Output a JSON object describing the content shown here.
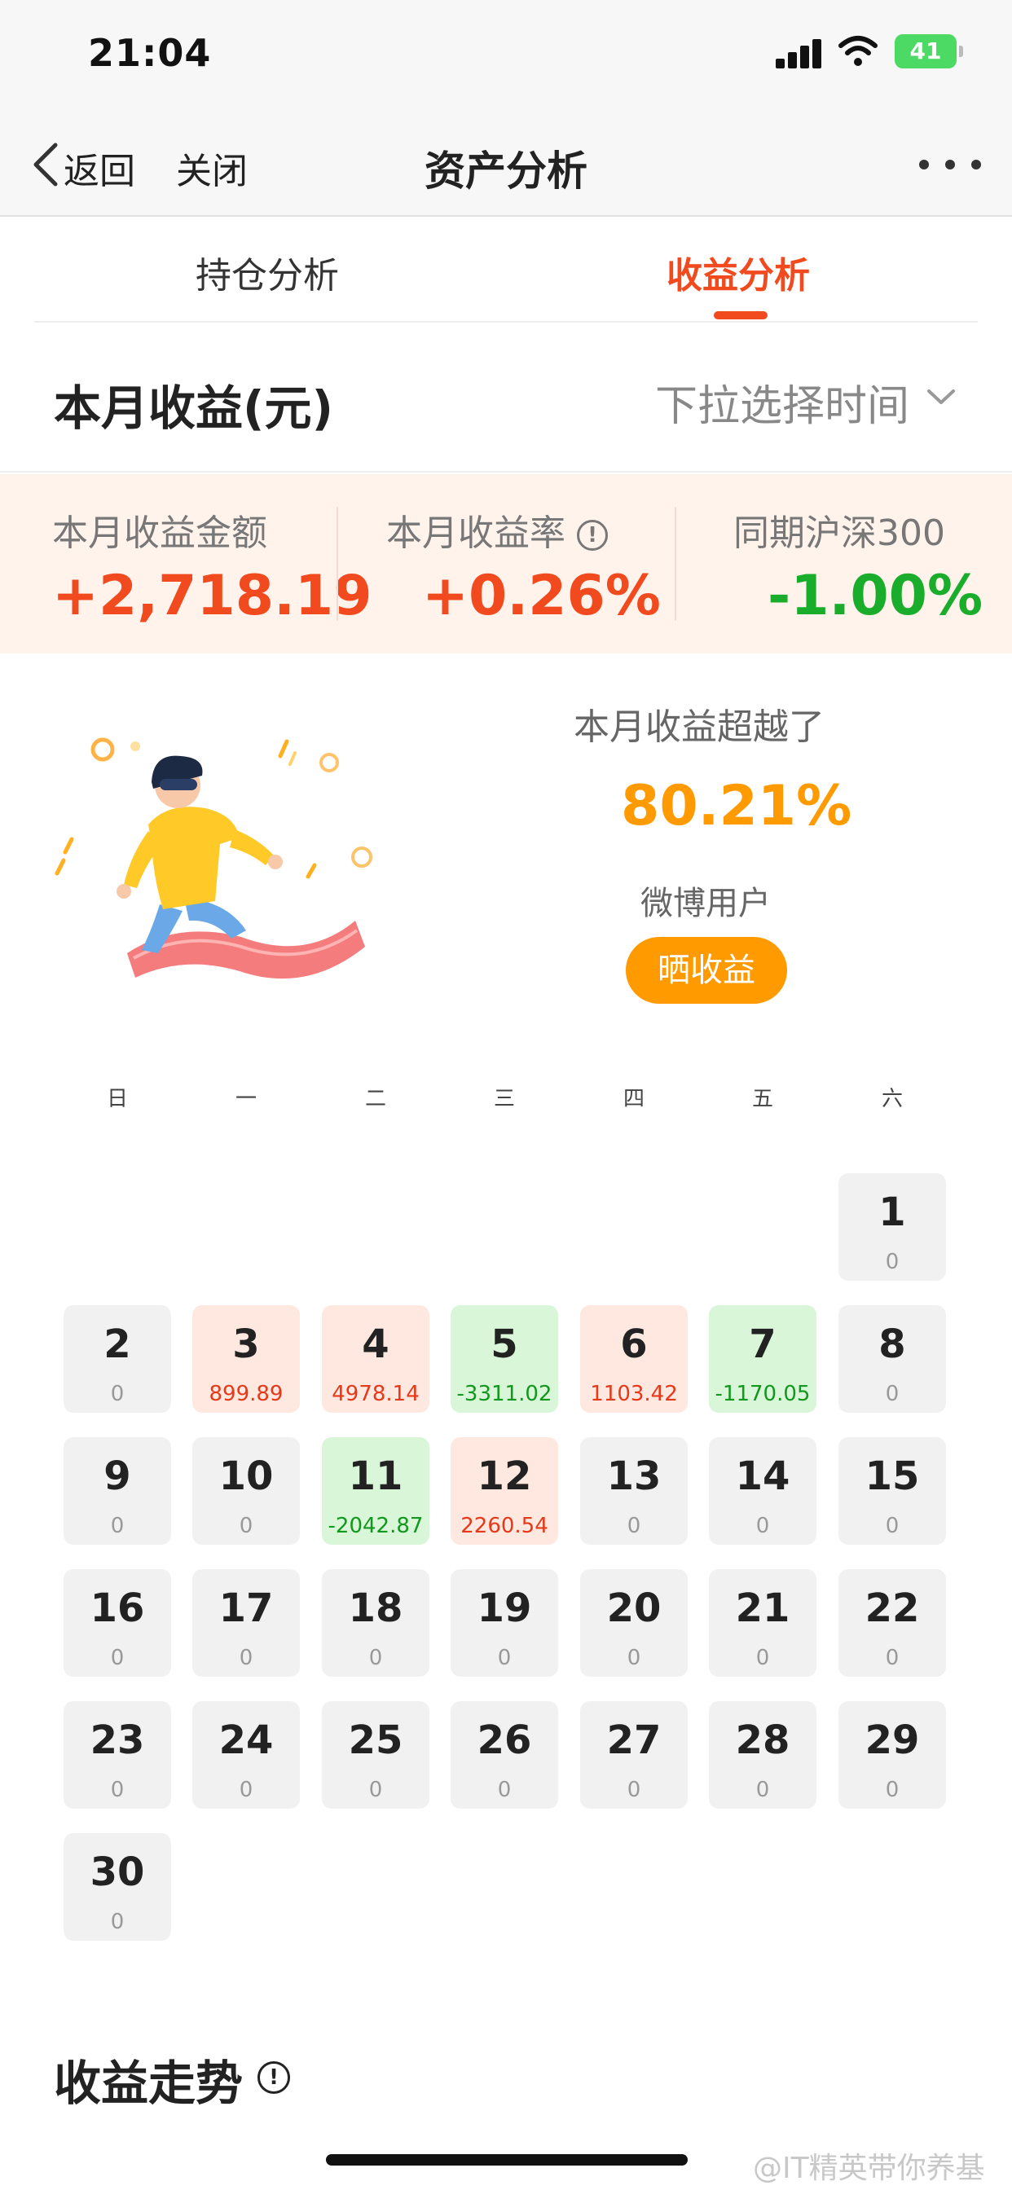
{
  "status_bar": {
    "time": "21:04",
    "battery": "41"
  },
  "nav": {
    "back_label": "返回",
    "close_label": "关闭",
    "title": "资产分析"
  },
  "tabs": [
    {
      "label": "持仓分析",
      "active": false
    },
    {
      "label": "收益分析",
      "active": true
    }
  ],
  "month": {
    "title": "本月收益(元)",
    "time_select": "下拉选择时间"
  },
  "stats": [
    {
      "label": "本月收益金额",
      "value": "+2,718.19"
    },
    {
      "label": "本月收益率",
      "value": "+0.26%"
    },
    {
      "label": "同期沪深300",
      "value": "-1.00%"
    }
  ],
  "beat": {
    "label": "本月收益超越了",
    "value": "80.21%",
    "users": "微博用户",
    "share_label": "晒收益"
  },
  "weekdays": [
    "日",
    "一",
    "二",
    "三",
    "四",
    "五",
    "六"
  ],
  "calendar": {
    "first_weekday": 6,
    "days": [
      {
        "day": "1",
        "amount": "0",
        "status": "zero"
      },
      {
        "day": "2",
        "amount": "0",
        "status": "zero"
      },
      {
        "day": "3",
        "amount": "899.89",
        "status": "pos"
      },
      {
        "day": "4",
        "amount": "4978.14",
        "status": "pos"
      },
      {
        "day": "5",
        "amount": "-3311.02",
        "status": "neg"
      },
      {
        "day": "6",
        "amount": "1103.42",
        "status": "pos"
      },
      {
        "day": "7",
        "amount": "-1170.05",
        "status": "neg"
      },
      {
        "day": "8",
        "amount": "0",
        "status": "zero"
      },
      {
        "day": "9",
        "amount": "0",
        "status": "zero"
      },
      {
        "day": "10",
        "amount": "0",
        "status": "zero"
      },
      {
        "day": "11",
        "amount": "-2042.87",
        "status": "neg"
      },
      {
        "day": "12",
        "amount": "2260.54",
        "status": "pos"
      },
      {
        "day": "13",
        "amount": "0",
        "status": "zero"
      },
      {
        "day": "14",
        "amount": "0",
        "status": "zero"
      },
      {
        "day": "15",
        "amount": "0",
        "status": "zero"
      },
      {
        "day": "16",
        "amount": "0",
        "status": "zero"
      },
      {
        "day": "17",
        "amount": "0",
        "status": "zero"
      },
      {
        "day": "18",
        "amount": "0",
        "status": "zero"
      },
      {
        "day": "19",
        "amount": "0",
        "status": "zero"
      },
      {
        "day": "20",
        "amount": "0",
        "status": "zero"
      },
      {
        "day": "21",
        "amount": "0",
        "status": "zero"
      },
      {
        "day": "22",
        "amount": "0",
        "status": "zero"
      },
      {
        "day": "23",
        "amount": "0",
        "status": "zero"
      },
      {
        "day": "24",
        "amount": "0",
        "status": "zero"
      },
      {
        "day": "25",
        "amount": "0",
        "status": "zero"
      },
      {
        "day": "26",
        "amount": "0",
        "status": "zero"
      },
      {
        "day": "27",
        "amount": "0",
        "status": "zero"
      },
      {
        "day": "28",
        "amount": "0",
        "status": "zero"
      },
      {
        "day": "29",
        "amount": "0",
        "status": "zero"
      },
      {
        "day": "30",
        "amount": "0",
        "status": "zero"
      }
    ]
  },
  "trend": {
    "title": "收益走势"
  },
  "watermark": "@IT精英带你养基",
  "colors": {
    "accent": "#f04a1e",
    "gain": "#e5391a",
    "loss": "#13981f",
    "highlight": "#ff9a00"
  },
  "icons": [
    "back-icon",
    "more-icon",
    "chevron-down-icon",
    "info-icon",
    "signal-icon",
    "wifi-icon",
    "battery-icon"
  ]
}
